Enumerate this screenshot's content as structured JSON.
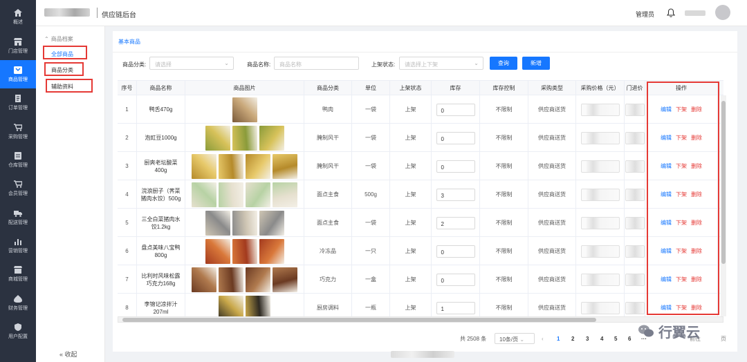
{
  "nav": {
    "items": [
      {
        "label": "概述",
        "icon": "home-icon"
      },
      {
        "label": "门店管理",
        "icon": "store-icon"
      },
      {
        "label": "商品管理",
        "icon": "goods-icon",
        "active": true
      },
      {
        "label": "订单管理",
        "icon": "order-icon"
      },
      {
        "label": "采购管理",
        "icon": "cart-icon"
      },
      {
        "label": "仓库管理",
        "icon": "warehouse-icon"
      },
      {
        "label": "会员管理",
        "icon": "member-icon"
      },
      {
        "label": "配送管理",
        "icon": "truck-icon"
      },
      {
        "label": "营销管理",
        "icon": "chart-icon"
      },
      {
        "label": "商城管理",
        "icon": "mall-icon"
      },
      {
        "label": "财务管理",
        "icon": "finance-icon"
      },
      {
        "label": "用户配置",
        "icon": "shield-icon"
      }
    ]
  },
  "header": {
    "system_title": "供应链后台",
    "admin_label": "管理员"
  },
  "subnav": {
    "group_label": "商品档案",
    "group_caret": "⌃",
    "items": [
      {
        "label": "全部商品",
        "active": true
      },
      {
        "label": "商品分类",
        "active": false
      },
      {
        "label": "辅助资料",
        "active": false
      }
    ],
    "collapse_label": "收起",
    "collapse_icon": "«"
  },
  "panel": {
    "title": "基本商品",
    "filters": {
      "category_label": "商品分类:",
      "category_placeholder": "请选择",
      "name_label": "商品名称:",
      "name_placeholder": "商品名称",
      "status_label": "上架状态:",
      "status_placeholder": "请选择上下架"
    },
    "query_button": "查询",
    "add_button": "新增"
  },
  "table": {
    "columns": [
      "序号",
      "商品名称",
      "商品图片",
      "商品分类",
      "单位",
      "上架状态",
      "库存",
      "库存控制",
      "采购类型",
      "采购价格（元）",
      "门进价",
      "操作"
    ],
    "op_labels": {
      "edit": "编辑",
      "down": "下架",
      "delete": "删除"
    },
    "rows": [
      {
        "no": "1",
        "name": "鸭舌470g",
        "category": "鸭肉",
        "unit": "一袋",
        "status": "上架",
        "stock": "0",
        "control": "不限制",
        "purchase_type": "供应商送货",
        "thumbs": 1
      },
      {
        "no": "2",
        "name": "泡豇豆1000g",
        "category": "腌制风干",
        "unit": "一袋",
        "status": "上架",
        "stock": "0",
        "control": "不限制",
        "purchase_type": "供应商送货",
        "thumbs": 3
      },
      {
        "no": "3",
        "name": "厨爽老坛酸菜400g",
        "category": "腌制风干",
        "unit": "一袋",
        "status": "上架",
        "stock": "0",
        "control": "不限制",
        "purchase_type": "供应商送货",
        "thumbs": 4
      },
      {
        "no": "4",
        "name": "浣浪厨子（荠菜猪肉水饺）500g",
        "category": "面点主食",
        "unit": "500g",
        "status": "上架",
        "stock": "3",
        "control": "不限制",
        "purchase_type": "供应商送货",
        "thumbs": 4
      },
      {
        "no": "5",
        "name": "三全白菜猪肉水饺1.2kg",
        "category": "面点主食",
        "unit": "一袋",
        "status": "上架",
        "stock": "2",
        "control": "不限制",
        "purchase_type": "供应商送货",
        "thumbs": 3
      },
      {
        "no": "6",
        "name": "盘点美味八宝鸭800g",
        "category": "冷冻品",
        "unit": "一只",
        "status": "上架",
        "stock": "0",
        "control": "不限制",
        "purchase_type": "供应商送货",
        "thumbs": 3
      },
      {
        "no": "7",
        "name": "比利时风味松露巧克力168g",
        "category": "巧克力",
        "unit": "一盒",
        "status": "上架",
        "stock": "0",
        "control": "不限制",
        "purchase_type": "供应商送货",
        "thumbs": 4
      },
      {
        "no": "8",
        "name": "李锦记凉拌汁207ml",
        "category": "厨房调料",
        "unit": "一瓶",
        "status": "上架",
        "stock": "1",
        "control": "不限制",
        "purchase_type": "供应商送货",
        "thumbs": 2
      }
    ]
  },
  "pagination": {
    "total": "共 2508 条",
    "page_size": "10条/页",
    "prev": "‹",
    "pages": [
      "1",
      "2",
      "3",
      "4",
      "5",
      "6",
      "···"
    ],
    "goto_label": "前往",
    "page_suffix": "页"
  },
  "watermark": "行翼云",
  "colors": {
    "sidebar": "#2b3240",
    "accent": "#1677ff",
    "danger": "#e53935",
    "annotation_box": "#e53935"
  }
}
